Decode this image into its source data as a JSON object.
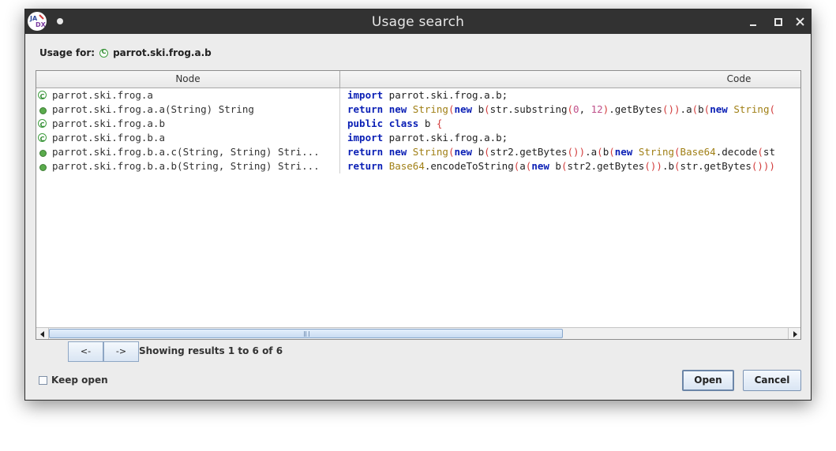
{
  "window": {
    "title": "Usage search",
    "app_icon": "jadx-logo-icon",
    "controls": [
      "minimize-icon",
      "maximize-icon",
      "close-icon"
    ]
  },
  "usage": {
    "label": "Usage for:",
    "target_icon": "class-icon",
    "target": "parrot.ski.frog.a.b"
  },
  "table": {
    "columns": [
      "Node",
      "Code"
    ],
    "rows": [
      {
        "icon": "class-icon",
        "node": "parrot.ski.frog.a",
        "code": [
          [
            "kw",
            "import"
          ],
          [
            "pl",
            " parrot.ski.frog.a.b;"
          ]
        ]
      },
      {
        "icon": "method-icon",
        "node": "parrot.ski.frog.a.a(String) String",
        "code": [
          [
            "kw",
            "return"
          ],
          [
            "pl",
            " "
          ],
          [
            "kw",
            "new"
          ],
          [
            "pl",
            " "
          ],
          [
            "ty",
            "String"
          ],
          [
            "pn",
            "("
          ],
          [
            "kw",
            "new"
          ],
          [
            "pl",
            " b"
          ],
          [
            "pn",
            "("
          ],
          [
            "pl",
            "str.substring"
          ],
          [
            "pn",
            "("
          ],
          [
            "nm",
            "0"
          ],
          [
            "pl",
            ", "
          ],
          [
            "nm",
            "12"
          ],
          [
            "pn",
            ")"
          ],
          [
            "pl",
            ".getBytes"
          ],
          [
            "pn",
            "()"
          ],
          [
            "pn",
            ")"
          ],
          [
            "pl",
            ".a"
          ],
          [
            "pn",
            "("
          ],
          [
            "pl",
            "b"
          ],
          [
            "pn",
            "("
          ],
          [
            "kw",
            "new"
          ],
          [
            "pl",
            " "
          ],
          [
            "ty",
            "String"
          ],
          [
            "pn",
            "("
          ]
        ]
      },
      {
        "icon": "class-icon",
        "node": "parrot.ski.frog.a.b",
        "code": [
          [
            "kw",
            "public"
          ],
          [
            "pl",
            " "
          ],
          [
            "kw",
            "class"
          ],
          [
            "pl",
            " b "
          ],
          [
            "pn",
            "{"
          ]
        ]
      },
      {
        "icon": "class-icon",
        "node": "parrot.ski.frog.b.a",
        "code": [
          [
            "kw",
            "import"
          ],
          [
            "pl",
            " parrot.ski.frog.a.b;"
          ]
        ]
      },
      {
        "icon": "method-icon",
        "node": "parrot.ski.frog.b.a.c(String, String) Stri...",
        "code": [
          [
            "kw",
            "return"
          ],
          [
            "pl",
            " "
          ],
          [
            "kw",
            "new"
          ],
          [
            "pl",
            " "
          ],
          [
            "ty",
            "String"
          ],
          [
            "pn",
            "("
          ],
          [
            "kw",
            "new"
          ],
          [
            "pl",
            " b"
          ],
          [
            "pn",
            "("
          ],
          [
            "pl",
            "str2.getBytes"
          ],
          [
            "pn",
            "()"
          ],
          [
            "pn",
            ")"
          ],
          [
            "pl",
            ".a"
          ],
          [
            "pn",
            "("
          ],
          [
            "pl",
            "b"
          ],
          [
            "pn",
            "("
          ],
          [
            "kw",
            "new"
          ],
          [
            "pl",
            " "
          ],
          [
            "ty",
            "String"
          ],
          [
            "pn",
            "("
          ],
          [
            "ty",
            "Base64"
          ],
          [
            "pl",
            ".decode"
          ],
          [
            "pn",
            "("
          ],
          [
            "pl",
            "st"
          ]
        ]
      },
      {
        "icon": "method-icon",
        "node": "parrot.ski.frog.b.a.b(String, String) Stri...",
        "code": [
          [
            "kw",
            "return"
          ],
          [
            "pl",
            " "
          ],
          [
            "ty",
            "Base64"
          ],
          [
            "pl",
            ".encodeToString"
          ],
          [
            "pn",
            "("
          ],
          [
            "pl",
            "a"
          ],
          [
            "pn",
            "("
          ],
          [
            "kw",
            "new"
          ],
          [
            "pl",
            " b"
          ],
          [
            "pn",
            "("
          ],
          [
            "pl",
            "str2.getBytes"
          ],
          [
            "pn",
            "()"
          ],
          [
            "pn",
            ")"
          ],
          [
            "pl",
            ".b"
          ],
          [
            "pn",
            "("
          ],
          [
            "pl",
            "str.getBytes"
          ],
          [
            "pn",
            "()"
          ],
          [
            "pn",
            "))"
          ]
        ]
      }
    ]
  },
  "navigation": {
    "prev_label": "<-",
    "next_label": "->",
    "results": "Showing results 1 to 6 of 6"
  },
  "footer": {
    "keep_open_label": "Keep open",
    "keep_open_checked": false,
    "open_label": "Open",
    "cancel_label": "Cancel"
  },
  "colors": {
    "keyword": "#0a1fb5",
    "type": "#a07f15",
    "paren": "#d23b3b",
    "number": "#c0508a",
    "titlebar": "#323232"
  }
}
